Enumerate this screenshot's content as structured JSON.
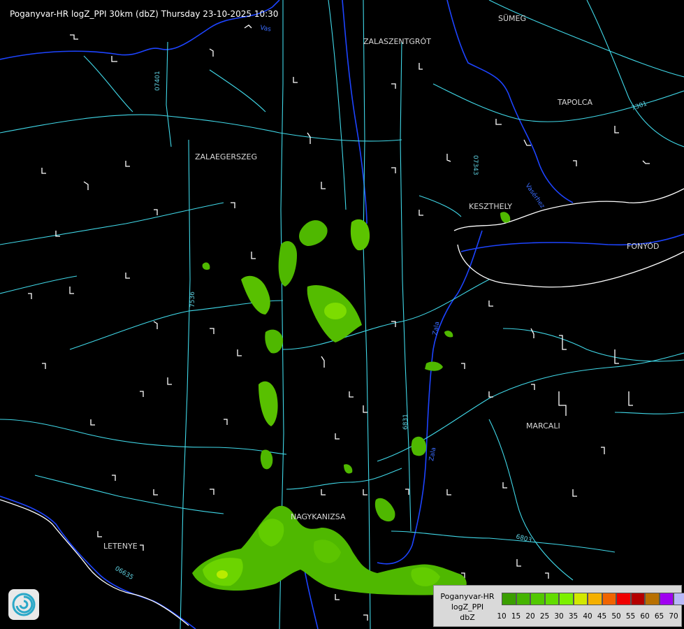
{
  "title": "Poganyvar-HR logZ_PPI 30km (dbZ) Thursday 23-10-2025 10:30",
  "cities": [
    {
      "name": "SÜMEG"
    },
    {
      "name": "ZALASZENTGRÓT"
    },
    {
      "name": "TAPOLCA"
    },
    {
      "name": "ZALAEGERSZEG"
    },
    {
      "name": "KESZTHELY"
    },
    {
      "name": "FONYÓD"
    },
    {
      "name": "MARCALI"
    },
    {
      "name": "NAGYKANIZSA"
    },
    {
      "name": "LETENYE"
    }
  ],
  "road_numbers": [
    "07401",
    "07343",
    "7301",
    "7536",
    "6831",
    "6803",
    "06635"
  ],
  "rivers": [
    "Zala",
    "Vasérhez",
    "Vas",
    "Zala"
  ],
  "legend": {
    "line1": "Poganyvar-HR",
    "line2": "logZ_PPI",
    "line3": "dbZ",
    "bins": [
      {
        "value": "10",
        "color": "#3a9e00"
      },
      {
        "value": "15",
        "color": "#45b400"
      },
      {
        "value": "20",
        "color": "#52c800"
      },
      {
        "value": "25",
        "color": "#62dc00"
      },
      {
        "value": "30",
        "color": "#7cf000"
      },
      {
        "value": "35",
        "color": "#d2e800"
      },
      {
        "value": "40",
        "color": "#f4b000"
      },
      {
        "value": "45",
        "color": "#f06400"
      },
      {
        "value": "50",
        "color": "#f00000"
      },
      {
        "value": "55",
        "color": "#b40000"
      },
      {
        "value": "60",
        "color": "#b87000"
      },
      {
        "value": "65",
        "color": "#a000f0"
      },
      {
        "value": "70",
        "color": "#b8b8f8"
      }
    ]
  },
  "colors": {
    "background": "#000000",
    "roads": "#40d8e8",
    "rivers": "#1040ff",
    "borders": "#ffffff",
    "echo_weak": "#3fa800",
    "echo_mid": "#6cd400",
    "echo_strong": "#c8f000"
  }
}
